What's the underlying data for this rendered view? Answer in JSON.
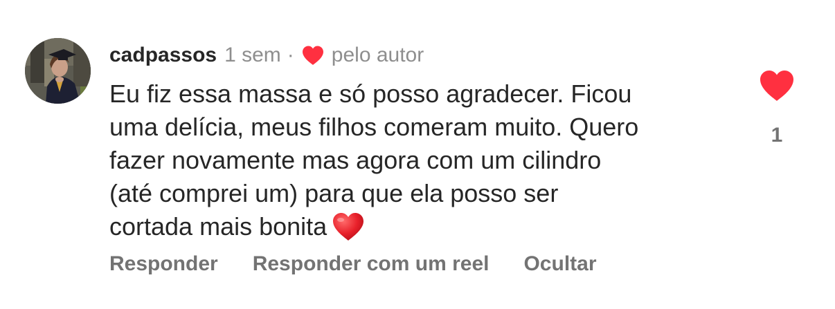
{
  "comment": {
    "username": "cadpassos",
    "time": "1 sem",
    "separator": "·",
    "liked_by_author_label": "pelo autor",
    "text_lines": [
      "Eu fiz essa massa e só posso agradecer. Ficou",
      "uma delícia, meus filhos comeram muito. Quero",
      "fazer novamente mas agora com um cilindro",
      "(até comprei um) para que ela posso ser",
      "cortada mais bonita"
    ],
    "emoji": "red-heart-emoji"
  },
  "likes": {
    "count": "1",
    "liked": true,
    "icon": "heart-icon"
  },
  "actions": {
    "reply_label": "Responder",
    "reply_reel_label": "Responder com um reel",
    "hide_label": "Ocultar"
  },
  "colors": {
    "heart_red": "#ff3040",
    "primary_text": "#262626",
    "secondary_text": "#8e8e8e",
    "action_text": "#737373"
  }
}
